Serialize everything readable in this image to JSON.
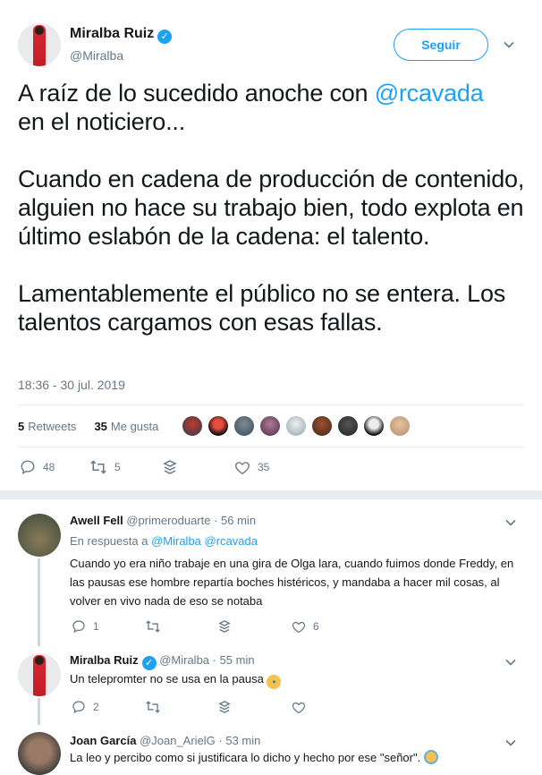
{
  "author": {
    "name": "Miralba Ruiz",
    "handle": "@Miralba",
    "follow_label": "Seguir"
  },
  "tweet": {
    "line1_prefix": "A raíz de lo sucedido anoche con ",
    "line1_mention": "@rcavada",
    "line2": "en el noticiero...",
    "para2": "Cuando en cadena de producción de contenido, alguien no hace su trabajo bien, todo explota en último eslabón de la cadena: el talento.",
    "para3": "Lamentablemente el público no se entera. Los talentos cargamos con esas fallas.",
    "timestamp": "18:36 - 30 jul. 2019"
  },
  "stats": {
    "retweets_count": "5",
    "retweets_label": "Retweets",
    "likes_count": "35",
    "likes_label": "Me gusta"
  },
  "actions": {
    "replies": "48",
    "retweets": "5",
    "likes": "35"
  },
  "replies": [
    {
      "name": "Awell Fell",
      "meta": "@primeroduarte · 56 min",
      "inreply_label": "En respuesta a",
      "inreply_mentions": "@Miralba @rcavada",
      "text": "Cuando yo era niño trabaje en una gira de Olga lara, cuando fuimos donde Freddy, en las pausas ese hombre repartía boches histéricos, y mandaba a hacer mil cosas, al volver en vivo nada de eso se notaba",
      "reply_count": "1",
      "retweet_count": "",
      "like_count": "6"
    },
    {
      "name": "Miralba Ruiz",
      "meta": "@Miralba · 55 min",
      "text": "Un telepromter no se usa en la pausa",
      "emoji": "crying-face",
      "reply_count": "2",
      "retweet_count": "",
      "like_count": ""
    },
    {
      "name": "Joan García",
      "meta": "@Joan_ArielG · 53 min",
      "text": "La leo y percibo como si justificara lo dicho y hecho por ese \"señor\".",
      "emoji": "praying-face"
    }
  ],
  "colors": {
    "accent": "#1da1f2",
    "muted": "#657786",
    "text": "#14171a",
    "border": "#e6ecf0"
  }
}
